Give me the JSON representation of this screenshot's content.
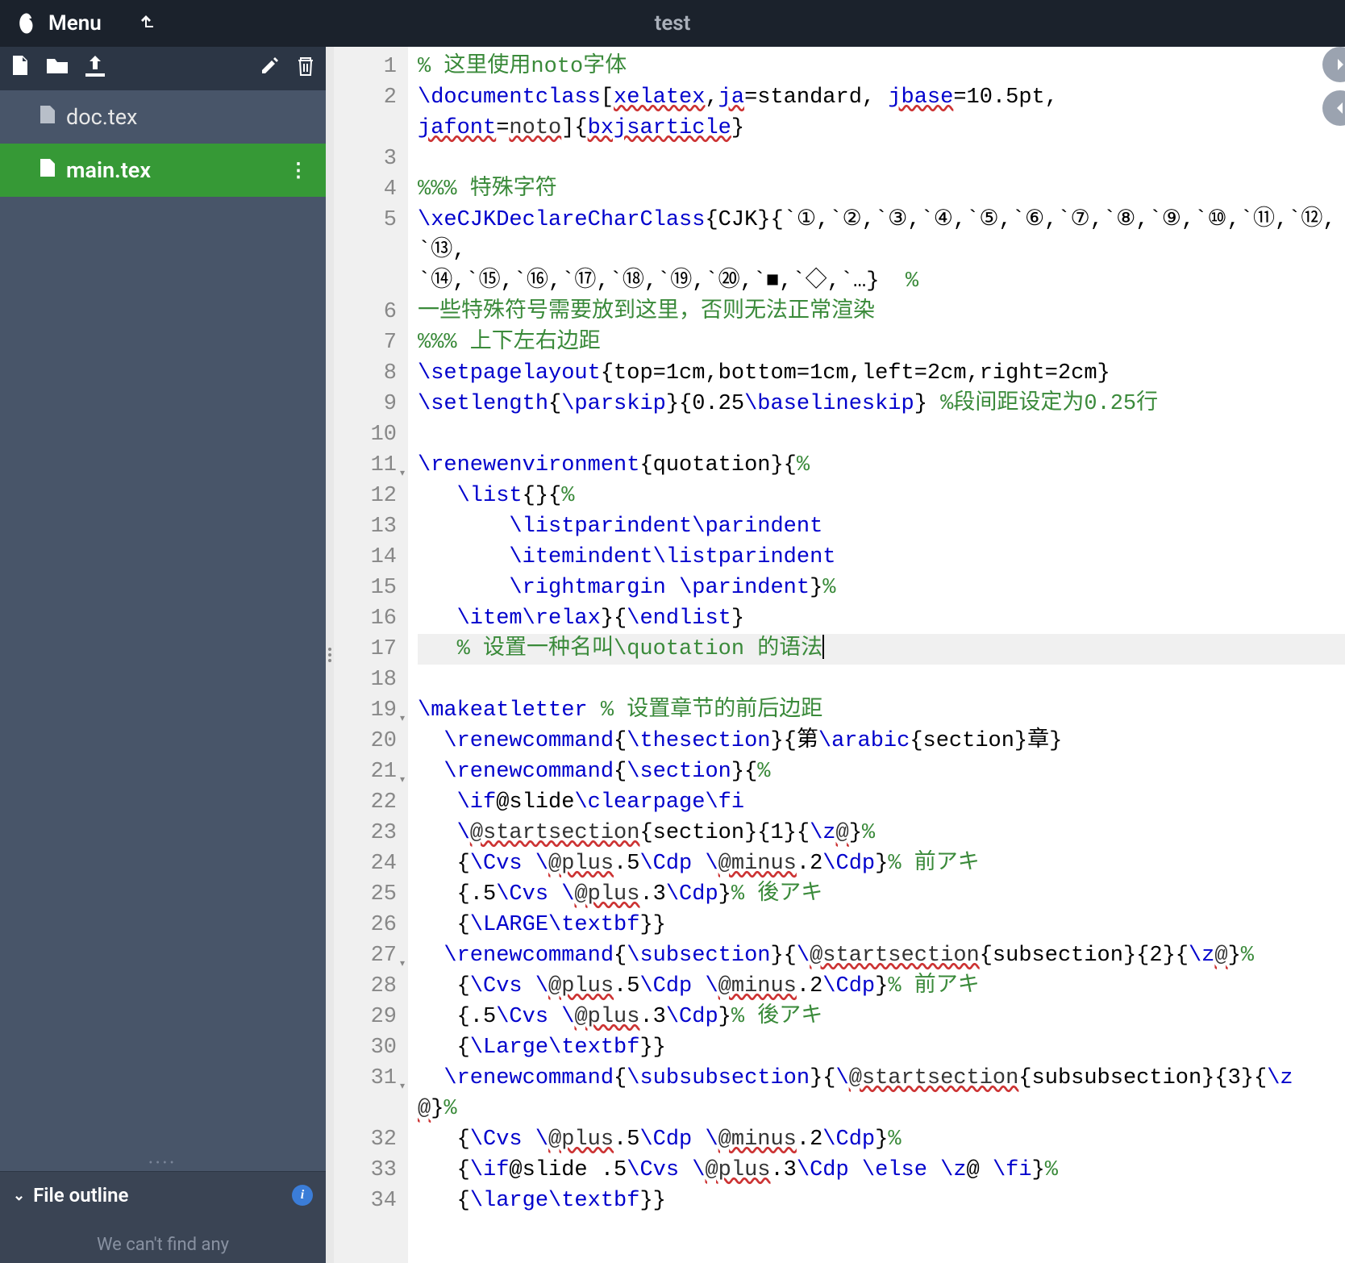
{
  "header": {
    "menu_label": "Menu",
    "project_title": "test"
  },
  "sidebar": {
    "files": [
      {
        "name": "doc.tex",
        "active": false
      },
      {
        "name": "main.tex",
        "active": true
      }
    ],
    "outline_title": "File outline",
    "outline_empty": "We can't find any"
  },
  "editor": {
    "lines": [
      {
        "n": 1,
        "html": "<span class='tok-comment'>% 这里使用noto字体</span>"
      },
      {
        "n": 2,
        "wrap": 2,
        "html": "<span class='tok-cmd'>\\documentclass</span>[<span class='tok-err'>xelatex</span>,<span class='tok-err'>ja</span>=standard, <span class='tok-err'>jbase</span>=10.5pt,<br><span class='tok-err'>jafont</span>=<span class='tok-err2'>noto</span>]{<span class='tok-err'>bxjsarticle</span>}"
      },
      {
        "n": 3,
        "html": ""
      },
      {
        "n": 4,
        "html": "<span class='tok-comment'>%%% 特殊字符</span>"
      },
      {
        "n": 5,
        "wrap": 3,
        "html": "<span class='tok-cmd'>\\xeCJKDeclareCharClass</span>{CJK}{`①,`②,`③,`④,`⑤,`⑥,`⑦,`⑧,`⑨,`⑩,`⑪,`⑫,`⑬,<br>`⑭,`⑮,`⑯,`⑰,`⑱,`⑲,`⑳,`■,`◇,`…}  <span class='tok-comment'>%</span><br><span class='tok-comment'>一些特殊符号需要放到这里，否则无法正常渲染</span>"
      },
      {
        "n": 6,
        "html": ""
      },
      {
        "n": 7,
        "html": "<span class='tok-comment'>%%% 上下左右边距</span>"
      },
      {
        "n": 8,
        "html": "<span class='tok-cmd'>\\setpagelayout</span>{top=1cm,bottom=1cm,left=2cm,right=2cm}"
      },
      {
        "n": 9,
        "html": "<span class='tok-cmd'>\\setlength</span>{<span class='tok-cmd'>\\parskip</span>}{0.25<span class='tok-cmd'>\\baselineskip</span>} <span class='tok-comment'>%段间距设定为0.25行</span>"
      },
      {
        "n": 10,
        "html": ""
      },
      {
        "n": 11,
        "fold": true,
        "html": "<span class='tok-cmd'>\\renewenvironment</span>{quotation}{<span class='tok-comment'>%</span>"
      },
      {
        "n": 12,
        "html": "   <span class='tok-cmd'>\\list</span>{}{<span class='tok-comment'>%</span>"
      },
      {
        "n": 13,
        "html": "       <span class='tok-cmd'>\\listparindent\\parindent</span>"
      },
      {
        "n": 14,
        "html": "       <span class='tok-cmd'>\\itemindent\\listparindent</span>"
      },
      {
        "n": 15,
        "html": "       <span class='tok-cmd'>\\rightmargin</span> <span class='tok-cmd'>\\parindent</span>}<span class='tok-comment'>%</span>"
      },
      {
        "n": 16,
        "html": "   <span class='tok-cmd'>\\item\\relax</span>}{<span class='tok-cmd'>\\endlist</span>}"
      },
      {
        "n": 17,
        "active": true,
        "html": "   <span class='tok-comment'>% 设置一种名叫\\quotation 的语法</span><span class='cursor-mark'></span>"
      },
      {
        "n": 18,
        "html": ""
      },
      {
        "n": 19,
        "fold": true,
        "html": "<span class='tok-cmd'>\\makeatletter</span> <span class='tok-comment'>% 设置章节的前后边距</span>"
      },
      {
        "n": 20,
        "html": "  <span class='tok-cmd'>\\renewcommand</span>{<span class='tok-cmd'>\\thesection</span>}{第<span class='tok-cmd'>\\arabic</span>{section}章}"
      },
      {
        "n": 21,
        "fold": true,
        "html": "  <span class='tok-cmd'>\\renewcommand</span>{<span class='tok-cmd'>\\section</span>}{<span class='tok-comment'>%</span>"
      },
      {
        "n": 22,
        "html": "   <span class='tok-cmd'>\\if</span>@slide<span class='tok-cmd'>\\clearpage\\fi</span>"
      },
      {
        "n": 23,
        "html": "   <span class='tok-cmd'>\\</span><span class='tok-err2'>@startsection</span>{section}{1}{<span class='tok-cmd'>\\z</span><span class='tok-err2'>@</span>}<span class='tok-comment'>%</span>"
      },
      {
        "n": 24,
        "html": "   {<span class='tok-cmd'>\\Cvs</span> <span class='tok-cmd'>\\</span><span class='tok-err2'>@plus</span>.5<span class='tok-cmd'>\\Cdp</span> <span class='tok-cmd'>\\</span><span class='tok-err2'>@minus</span>.2<span class='tok-cmd'>\\Cdp</span>}<span class='tok-comment'>% 前アキ</span>"
      },
      {
        "n": 25,
        "html": "   {.5<span class='tok-cmd'>\\Cvs</span> <span class='tok-cmd'>\\</span><span class='tok-err2'>@plus</span>.3<span class='tok-cmd'>\\Cdp</span>}<span class='tok-comment'>% 後アキ</span>"
      },
      {
        "n": 26,
        "html": "   {<span class='tok-cmd'>\\LARGE\\textbf</span>}}"
      },
      {
        "n": 27,
        "fold": true,
        "html": "  <span class='tok-cmd'>\\renewcommand</span>{<span class='tok-cmd'>\\subsection</span>}{<span class='tok-cmd'>\\</span><span class='tok-err2'>@startsection</span>{subsection}{2}{<span class='tok-cmd'>\\z</span><span class='tok-err2'>@</span>}<span class='tok-comment'>%</span>"
      },
      {
        "n": 28,
        "html": "   {<span class='tok-cmd'>\\Cvs</span> <span class='tok-cmd'>\\</span><span class='tok-err2'>@plus</span>.5<span class='tok-cmd'>\\Cdp</span> <span class='tok-cmd'>\\</span><span class='tok-err2'>@minus</span>.2<span class='tok-cmd'>\\Cdp</span>}<span class='tok-comment'>% 前アキ</span>"
      },
      {
        "n": 29,
        "html": "   {.5<span class='tok-cmd'>\\Cvs</span> <span class='tok-cmd'>\\</span><span class='tok-err2'>@plus</span>.3<span class='tok-cmd'>\\Cdp</span>}<span class='tok-comment'>% 後アキ</span>"
      },
      {
        "n": 30,
        "html": "   {<span class='tok-cmd'>\\Large\\textbf</span>}}"
      },
      {
        "n": 31,
        "wrap": 2,
        "fold": true,
        "html": "  <span class='tok-cmd'>\\renewcommand</span>{<span class='tok-cmd'>\\subsubsection</span>}{<span class='tok-cmd'>\\</span><span class='tok-err2'>@startsection</span>{subsubsection}{3}{<span class='tok-cmd'>\\z</span><br><span class='tok-err2'>@</span>}<span class='tok-comment'>%</span>"
      },
      {
        "n": 32,
        "html": "   {<span class='tok-cmd'>\\Cvs</span> <span class='tok-cmd'>\\</span><span class='tok-err2'>@plus</span>.5<span class='tok-cmd'>\\Cdp</span> <span class='tok-cmd'>\\</span><span class='tok-err2'>@minus</span>.2<span class='tok-cmd'>\\Cdp</span>}<span class='tok-comment'>%</span>"
      },
      {
        "n": 33,
        "html": "   {<span class='tok-cmd'>\\if</span>@slide .5<span class='tok-cmd'>\\Cvs</span> <span class='tok-cmd'>\\</span><span class='tok-err2'>@plus</span>.3<span class='tok-cmd'>\\Cdp</span> <span class='tok-cmd'>\\else</span> <span class='tok-cmd'>\\z</span>@ <span class='tok-cmd'>\\fi</span>}<span class='tok-comment'>%</span>"
      },
      {
        "n": 34,
        "html": "   {<span class='tok-cmd'>\\large\\textbf</span>}}"
      }
    ]
  }
}
